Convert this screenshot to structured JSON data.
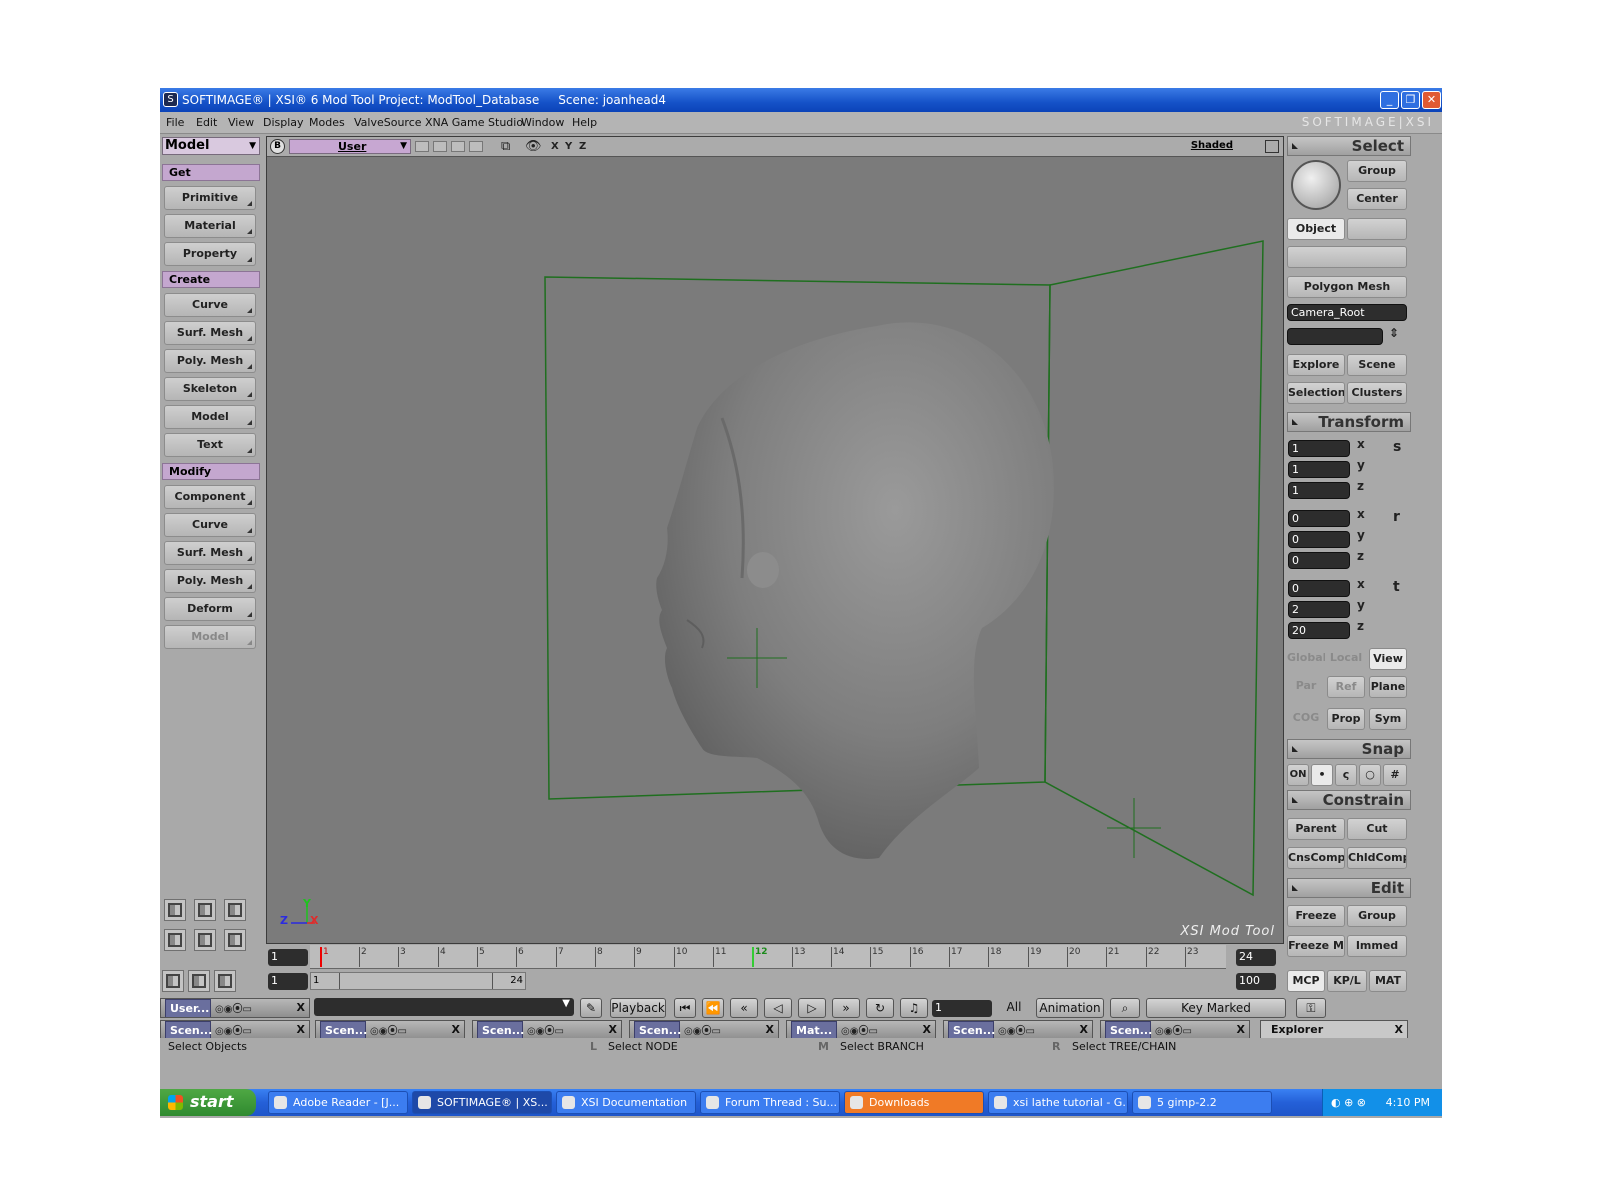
{
  "title": "SOFTIMAGE® | XSI® 6 Mod Tool Project: ModTool_Database     Scene: joanhead4",
  "menu": [
    "File",
    "Edit",
    "View",
    "Display",
    "Modes",
    "ValveSource",
    "XNA Game Studio",
    "Window",
    "Help"
  ],
  "brand": "SOFTIMAGE|XSI",
  "left": {
    "mode": "Model",
    "sections": {
      "get": "Get",
      "create": "Create",
      "modify": "Modify"
    },
    "get_items": [
      "Primitive",
      "Material",
      "Property"
    ],
    "create_items": [
      "Curve",
      "Surf. Mesh",
      "Poly. Mesh",
      "Skeleton",
      "Model",
      "Text"
    ],
    "modify_items": [
      "Component",
      "Curve",
      "Surf. Mesh",
      "Poly. Mesh",
      "Deform",
      "Model"
    ]
  },
  "viewport": {
    "b_label": "B",
    "camera": "User",
    "axes": [
      "X",
      "Y",
      "Z"
    ],
    "shading": "Shaded",
    "watermark": "XSI  Mod  Tool",
    "axis_y": "Y",
    "axis_z": "Z",
    "axis_x": "X"
  },
  "right": {
    "select": {
      "header": "Select",
      "group": "Group",
      "center": "Center",
      "object": "Object",
      "filter": "Polygon Mesh",
      "name": "Camera_Root",
      "explore": "Explore",
      "scene": "Scene",
      "selection": "Selection",
      "clusters": "Clusters"
    },
    "transform": {
      "header": "Transform",
      "scale": [
        "1",
        "1",
        "1"
      ],
      "rotate": [
        "0",
        "0",
        "0"
      ],
      "translate": [
        "0",
        "2",
        "20"
      ],
      "axis_labels": [
        "x",
        "y",
        "z"
      ],
      "s": "s",
      "r": "r",
      "t": "t",
      "global": "Global",
      "local": "Local",
      "view": "View",
      "par": "Par",
      "ref": "Ref",
      "plane": "Plane",
      "cog": "COG",
      "prop": "Prop",
      "sym": "Sym"
    },
    "snap": {
      "header": "Snap",
      "on": "ON"
    },
    "constrain": {
      "header": "Constrain",
      "parent": "Parent",
      "cut": "Cut",
      "cnscomp": "CnsComp",
      "chldcomp": "ChldComp"
    },
    "edit": {
      "header": "Edit",
      "freeze": "Freeze",
      "group": "Group",
      "freeze_m": "Freeze M",
      "immed": "Immed"
    },
    "tabs": [
      "MCP",
      "KP/L",
      "MAT"
    ]
  },
  "timeline": {
    "current_frame": "1",
    "start_frame": "1",
    "end_frame": "24",
    "range_end": "100",
    "ticks": [
      "1",
      "2",
      "3",
      "4",
      "5",
      "6",
      "7",
      "8",
      "9",
      "10",
      "11",
      "12",
      "13",
      "14",
      "15",
      "16",
      "17",
      "18",
      "19",
      "20",
      "21",
      "22",
      "23"
    ],
    "range_start_label": "1",
    "range_end_label": "24"
  },
  "playback": {
    "label": "Playback",
    "frame": "1",
    "all": "All",
    "animation": "Animation",
    "key_marked": "Key Marked Parameters"
  },
  "bottom_tabs": [
    "User...",
    "Scen...",
    "Scen...",
    "Scen...",
    "Scen...",
    "Mat...",
    "Scen...",
    "Scen..."
  ],
  "explorer_tab": "Explorer",
  "status": {
    "left": "Select Objects",
    "l": "L",
    "l_text": "Select NODE",
    "m": "M",
    "m_text": "Select BRANCH",
    "r": "R",
    "r_text": "Select TREE/CHAIN"
  },
  "taskbar": {
    "start": "start",
    "tasks": [
      "Adobe Reader - [J...",
      "SOFTIMAGE® | XS...",
      "XSI Documentation",
      "Forum Thread : Su...",
      "Downloads",
      "xsi lathe tutorial - G...",
      "5 gimp-2.2"
    ],
    "clock": "4:10 PM"
  }
}
